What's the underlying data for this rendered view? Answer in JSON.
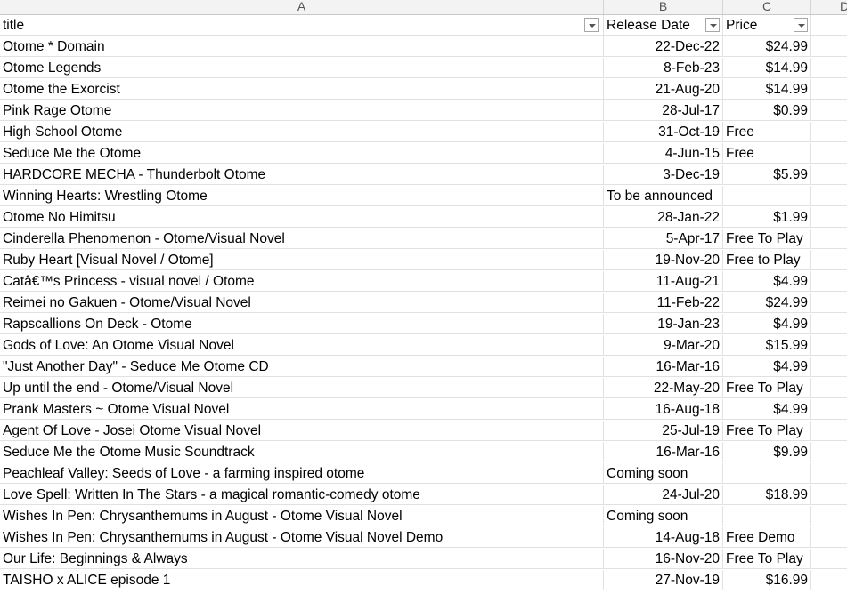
{
  "column_headers": [
    "A",
    "B",
    "C",
    "D"
  ],
  "headers": {
    "title": "title",
    "release_date": "Release Date",
    "price": "Price"
  },
  "rows": [
    {
      "title": "Otome * Domain",
      "date": "22-Dec-22",
      "price": "$24.99"
    },
    {
      "title": "Otome Legends",
      "date": "8-Feb-23",
      "price": "$14.99"
    },
    {
      "title": "Otome the Exorcist",
      "date": "21-Aug-20",
      "price": "$14.99"
    },
    {
      "title": "Pink Rage Otome",
      "date": "28-Jul-17",
      "price": "$0.99"
    },
    {
      "title": "High School Otome",
      "date": "31-Oct-19",
      "price": "Free"
    },
    {
      "title": "Seduce Me the Otome",
      "date": "4-Jun-15",
      "price": "Free"
    },
    {
      "title": "HARDCORE MECHA - Thunderbolt Otome",
      "date": "3-Dec-19",
      "price": "$5.99"
    },
    {
      "title": "Winning Hearts: Wrestling Otome",
      "date": "To be announced",
      "price": ""
    },
    {
      "title": "Otome No Himitsu",
      "date": "28-Jan-22",
      "price": "$1.99"
    },
    {
      "title": "Cinderella Phenomenon - Otome/Visual Novel",
      "date": "5-Apr-17",
      "price": "Free To Play"
    },
    {
      "title": "Ruby Heart [Visual Novel / Otome]",
      "date": "19-Nov-20",
      "price": "Free to Play"
    },
    {
      "title": "Catâ€™s Princess - visual novel / Otome",
      "date": "11-Aug-21",
      "price": "$4.99"
    },
    {
      "title": "Reimei no Gakuen - Otome/Visual Novel",
      "date": "11-Feb-22",
      "price": "$24.99"
    },
    {
      "title": "Rapscallions On Deck - Otome",
      "date": "19-Jan-23",
      "price": "$4.99"
    },
    {
      "title": "Gods of Love: An Otome Visual Novel",
      "date": "9-Mar-20",
      "price": "$15.99"
    },
    {
      "title": "\"Just Another Day\" - Seduce Me Otome CD",
      "date": "16-Mar-16",
      "price": "$4.99"
    },
    {
      "title": "Up until the end - Otome/Visual Novel",
      "date": "22-May-20",
      "price": "Free To Play"
    },
    {
      "title": "Prank Masters ~ Otome Visual Novel",
      "date": "16-Aug-18",
      "price": "$4.99"
    },
    {
      "title": "Agent Of Love - Josei Otome Visual Novel",
      "date": "25-Jul-19",
      "price": "Free To Play"
    },
    {
      "title": "Seduce Me the Otome Music Soundtrack",
      "date": "16-Mar-16",
      "price": "$9.99"
    },
    {
      "title": "Peachleaf Valley: Seeds of Love - a farming inspired otome",
      "date": "Coming soon",
      "price": ""
    },
    {
      "title": "Love Spell: Written In The Stars - a magical romantic-comedy otome",
      "date": "24-Jul-20",
      "price": "$18.99"
    },
    {
      "title": "Wishes In Pen: Chrysanthemums in August - Otome Visual Novel",
      "date": "Coming soon",
      "price": ""
    },
    {
      "title": "Wishes In Pen: Chrysanthemums in August - Otome Visual Novel Demo",
      "date": "14-Aug-18",
      "price": "Free Demo"
    },
    {
      "title": "Our Life: Beginnings & Always",
      "date": "16-Nov-20",
      "price": "Free To Play"
    },
    {
      "title": "TAISHO x ALICE episode 1",
      "date": "27-Nov-19",
      "price": "$16.99"
    }
  ]
}
